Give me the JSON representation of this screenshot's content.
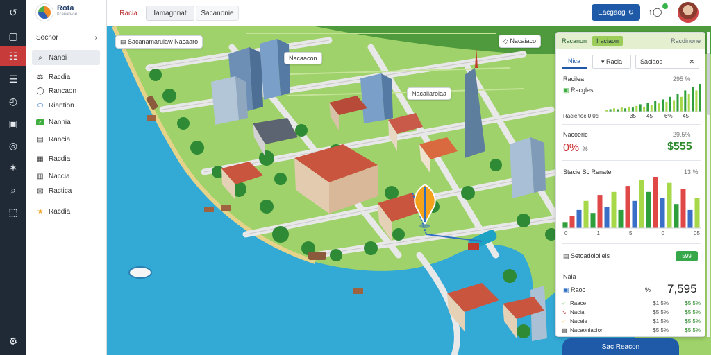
{
  "app": {
    "logo_name": "Rota",
    "logo_sub": "Ксавакнон"
  },
  "sidebar": {
    "section_title": "Secnor",
    "items": [
      {
        "label": "Nanoi",
        "icon": "search-icon"
      },
      {
        "label": "Racdia",
        "icon": "pin-icon"
      },
      {
        "label": "Rancaon",
        "icon": "layers-icon"
      },
      {
        "label": "Riantion",
        "icon": "route-icon"
      },
      {
        "label": "Nannia",
        "icon": "chart-icon"
      },
      {
        "label": "Rancia",
        "icon": "bag-icon"
      },
      {
        "label": "Racdia",
        "icon": "grid-icon"
      },
      {
        "label": "Naccia",
        "icon": "note-icon"
      },
      {
        "label": "Ractica",
        "icon": "calendar-icon"
      },
      {
        "label": "Racdia",
        "icon": "star-icon"
      }
    ]
  },
  "topbar": {
    "tabs": [
      "Racia",
      "Iamagnnat",
      "Sacanonie"
    ],
    "primary_button": "Eacgaog"
  },
  "map": {
    "labels": [
      "Sacanamaruiaw Nacaaro",
      "Nacaacon",
      "Nacaliarolaa",
      "Nacaiaco"
    ]
  },
  "panel": {
    "header": {
      "title": "Racanon",
      "tag": "Iraciaon",
      "right": "Racdinone"
    },
    "tabs": [
      "Nica",
      "Racia",
      "Saciaos"
    ],
    "section1": {
      "title": "Racilea",
      "title_value": "295 %",
      "item": "Racgles",
      "footer_label": "Racienoc 0 0c",
      "footer_values": [
        "35",
        "45",
        "6%",
        "45"
      ]
    },
    "section2": {
      "title": "Nacoeric",
      "title_value": "29.5%",
      "pct": "0%",
      "pct_small": "%",
      "money": "$555"
    },
    "section3": {
      "title": "Stacie Sc Renaten",
      "title_value": "13 %",
      "ticks": [
        "0",
        "1",
        "5",
        "0",
        "05"
      ]
    },
    "section4": {
      "title": "Setoadoloiiels",
      "badge": "599",
      "sub_title": "Naia",
      "primary_label": "Raoc",
      "primary_big": "7,595",
      "primary_icon_value": "%",
      "rows": [
        {
          "label": "Raace",
          "v1": "$1.5%",
          "v2": "$5.5%"
        },
        {
          "label": "Nacia",
          "v1": "$5.5%",
          "v2": "$5.5%"
        },
        {
          "label": "Naceie",
          "v1": "$1.5%",
          "v2": "$5.5%"
        },
        {
          "label": "Nacaoniacion",
          "v1": "$5.5%",
          "v2": "$5.5%"
        }
      ]
    }
  },
  "bottom_button": "Sac Reacon",
  "colors": {
    "rail": "#1f2a36",
    "accent_red": "#c73b3b",
    "primary_blue": "#1f5aa8",
    "water": "#33a9d6",
    "land": "#9fd26a",
    "bar_green": "#2e9f3a",
    "bar_red": "#e04848",
    "bar_blue": "#3a6fc8",
    "bar_lime": "#a7d84a"
  },
  "chart_data": [
    {
      "type": "bar",
      "values": [
        2,
        3,
        4,
        3,
        5,
        4,
        6,
        5,
        7,
        9,
        6,
        11,
        8,
        13,
        10,
        15,
        12,
        18,
        14,
        22,
        18,
        26,
        22,
        30,
        26,
        34
      ],
      "series_colors": [
        "#a7d84a",
        "#2e9f3a"
      ]
    },
    {
      "type": "bar",
      "values": [
        10,
        20,
        30,
        45,
        25,
        55,
        35,
        60,
        30,
        70,
        45,
        80,
        60,
        85,
        50,
        75,
        40,
        65,
        30,
        50
      ],
      "series_colors": [
        "#2e9f3a",
        "#e04848",
        "#3a6fc8",
        "#a7d84a"
      ],
      "ticks": [
        "0",
        "1",
        "5",
        "0",
        "05"
      ]
    }
  ]
}
